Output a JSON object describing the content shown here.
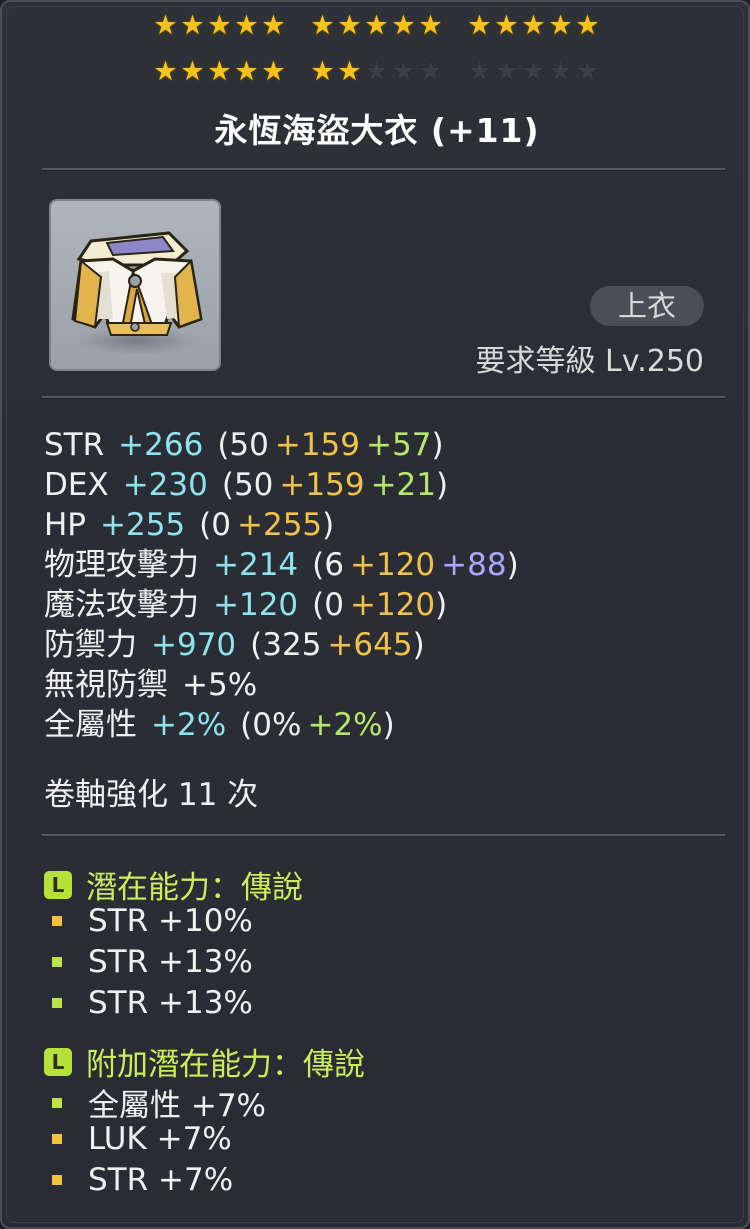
{
  "stars": {
    "total": 30,
    "filled": 22,
    "filled_color": "#f6c21c",
    "empty_color": "#3b3f46",
    "icon": "star-icon"
  },
  "item": {
    "name": "永恆海盜大衣 (+11)",
    "icon": "pirate-coat-icon",
    "type_badge": "上衣",
    "required_level": "要求等級  Lv.250"
  },
  "stats": [
    {
      "name": "STR",
      "total": "+266",
      "open": "(50",
      "parts": [
        {
          "text": "+159",
          "color": "gold"
        },
        {
          "text": "+57",
          "color": "green"
        }
      ],
      "close": ")"
    },
    {
      "name": "DEX",
      "total": "+230",
      "open": "(50",
      "parts": [
        {
          "text": "+159",
          "color": "gold"
        },
        {
          "text": "+21",
          "color": "green"
        }
      ],
      "close": ")"
    },
    {
      "name": "HP",
      "total": "+255",
      "open": "(0",
      "parts": [
        {
          "text": "+255",
          "color": "gold"
        }
      ],
      "close": ")"
    },
    {
      "name": "物理攻擊力",
      "total": "+214",
      "open": "(6",
      "parts": [
        {
          "text": "+120",
          "color": "gold"
        },
        {
          "text": "+88",
          "color": "purple"
        }
      ],
      "close": ")"
    },
    {
      "name": "魔法攻擊力",
      "total": "+120",
      "open": "(0",
      "parts": [
        {
          "text": "+120",
          "color": "gold"
        }
      ],
      "close": ")"
    },
    {
      "name": "防禦力",
      "total": "+970",
      "open": "(325",
      "parts": [
        {
          "text": "+645",
          "color": "gold"
        }
      ],
      "close": ")"
    },
    {
      "name": "無視防禦",
      "total": "+5%",
      "total_color": "white",
      "open": "",
      "parts": [],
      "close": ""
    },
    {
      "name": "全屬性",
      "total": "+2%",
      "open": "(0%",
      "parts": [
        {
          "text": "+2%",
          "color": "green"
        }
      ],
      "close": ")"
    }
  ],
  "scroll_upgrades": "卷軸強化 11 次",
  "potential": {
    "grade_icon_letter": "L",
    "header": "潛在能力：傳說",
    "lines": [
      {
        "text": "STR +10%",
        "bullet": "gold"
      },
      {
        "text": "STR +13%",
        "bullet": "green"
      },
      {
        "text": "STR +13%",
        "bullet": "green"
      }
    ]
  },
  "bonus_potential": {
    "grade_icon_letter": "L",
    "header": "附加潛在能力：傳說",
    "lines": [
      {
        "text": "全屬性 +7%",
        "bullet": "green"
      },
      {
        "text": "LUK +7%",
        "bullet": "gold"
      },
      {
        "text": "STR +7%",
        "bullet": "gold"
      }
    ]
  },
  "colors": {
    "stat_total": "#8ee3ee",
    "gold": "#f0c24a",
    "green": "#b8e66a",
    "purple": "#a8a6ff",
    "legendary": "#c9ee5a"
  }
}
